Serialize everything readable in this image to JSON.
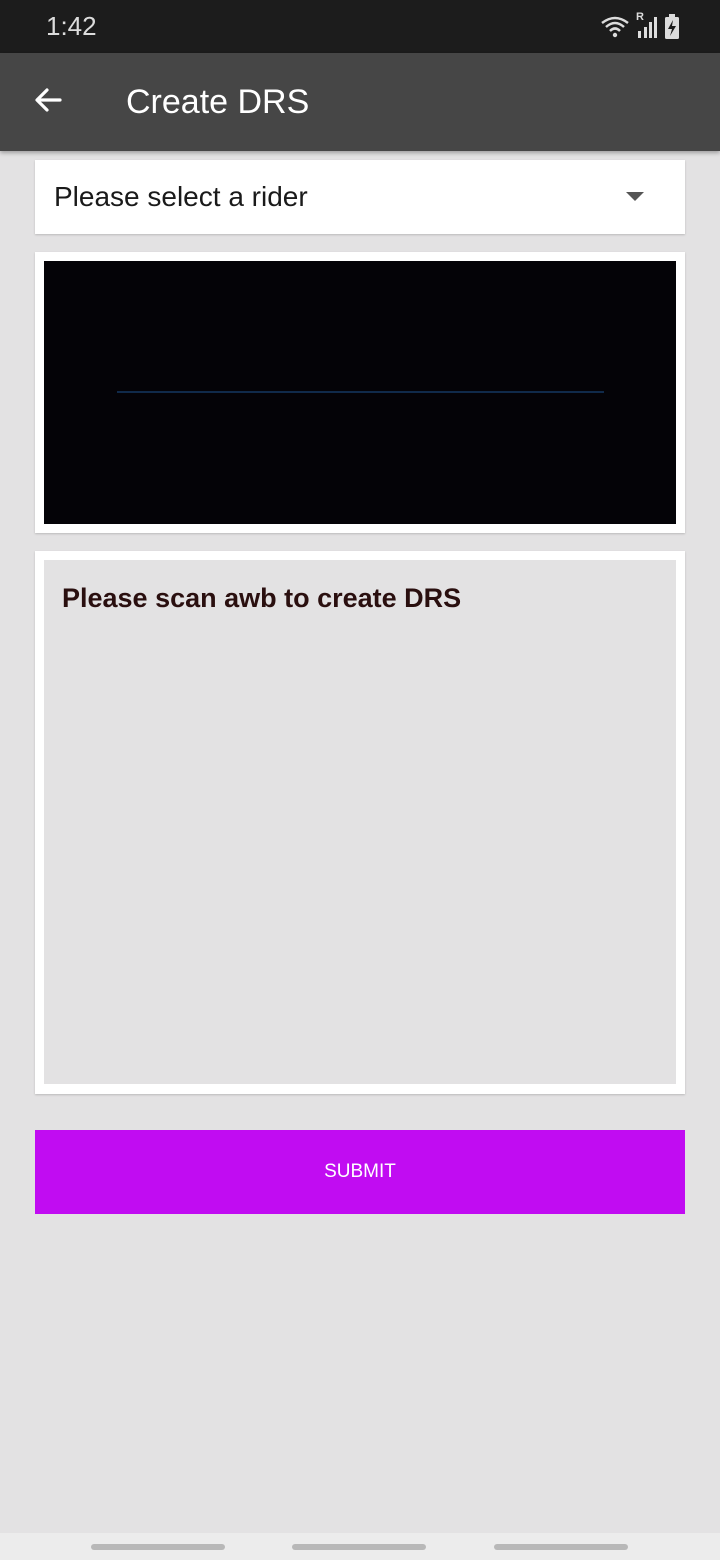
{
  "status_bar": {
    "time": "1:42",
    "icons": [
      "wifi-icon",
      "signal-icon",
      "battery-charging-icon"
    ],
    "roaming_label": "R"
  },
  "app_bar": {
    "back_icon": "arrow-left-icon",
    "title": "Create DRS"
  },
  "rider_select": {
    "placeholder": "Please select a rider",
    "icon": "dropdown-arrow-icon"
  },
  "awb_list": {
    "empty_message": "Please scan awb to create DRS"
  },
  "actions": {
    "submit_label": "SUBMIT"
  },
  "colors": {
    "status_bar": "#1c1c1c",
    "app_bar": "#464646",
    "background": "#e3e2e3",
    "accent": "#c10cf2"
  }
}
